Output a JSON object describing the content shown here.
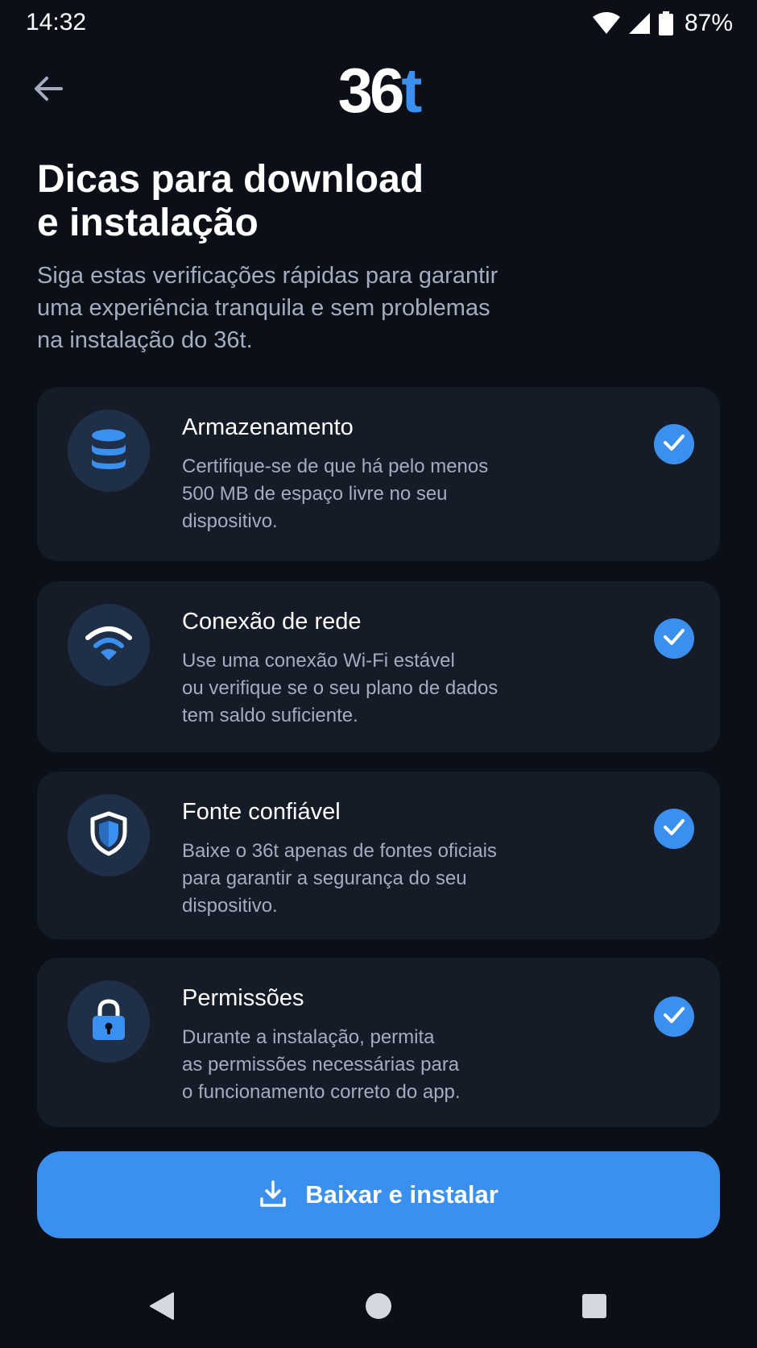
{
  "status_bar": {
    "time": "14:32",
    "battery_percent": "87%",
    "wifi_icon": "wifi-icon",
    "signal_icon": "cell-signal-icon",
    "battery_icon": "battery-icon"
  },
  "header": {
    "back_icon": "arrow-left-icon",
    "logo_main": "36",
    "logo_accent": "t"
  },
  "title_lines": [
    "Dicas para download",
    "e instalação"
  ],
  "subtitle_lines": [
    "Siga estas verificações rápidas para garantir",
    "uma experiência tranquila e sem problemas",
    "na instalação do 36t."
  ],
  "tips": [
    {
      "icon": "database-icon",
      "title": "Armazenamento",
      "desc_lines": [
        "Certifique-se de que há pelo menos",
        "500 MB de espaço livre no seu",
        "dispositivo."
      ],
      "checked": true
    },
    {
      "icon": "wifi-icon",
      "title": "Conexão de rede",
      "desc_lines": [
        "Use uma conexão Wi-Fi estável",
        "ou verifique se o seu plano de dados",
        "tem saldo suficiente."
      ],
      "checked": true
    },
    {
      "icon": "shield-icon",
      "title": "Fonte confiável",
      "desc_lines": [
        "Baixe o 36t apenas de fontes oficiais",
        "para garantir a segurança do seu",
        "dispositivo."
      ],
      "checked": true
    },
    {
      "icon": "lock-icon",
      "title": "Permissões",
      "desc_lines": [
        "Durante a instalação, permita",
        "as permissões necessárias para",
        "o funcionamento correto do app."
      ],
      "checked": true
    }
  ],
  "primary_action": {
    "icon": "download-icon",
    "label": "Baixar e instalar"
  },
  "nav": {
    "back_icon": "nav-back-icon",
    "home_icon": "nav-home-icon",
    "recents_icon": "nav-recents-icon"
  },
  "colors": {
    "background": "#0b0f17",
    "card": "#151c28",
    "icon_circle": "#1f2f48",
    "accent": "#3b8fef",
    "muted_text": "#a3adbf"
  }
}
